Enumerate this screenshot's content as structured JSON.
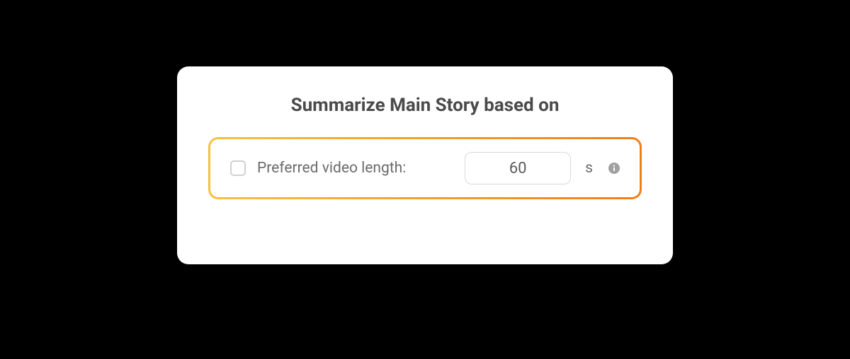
{
  "card": {
    "title": "Summarize Main Story based on",
    "option": {
      "checked": false,
      "label": "Preferred video length:",
      "value": "60",
      "unit": "s"
    }
  }
}
